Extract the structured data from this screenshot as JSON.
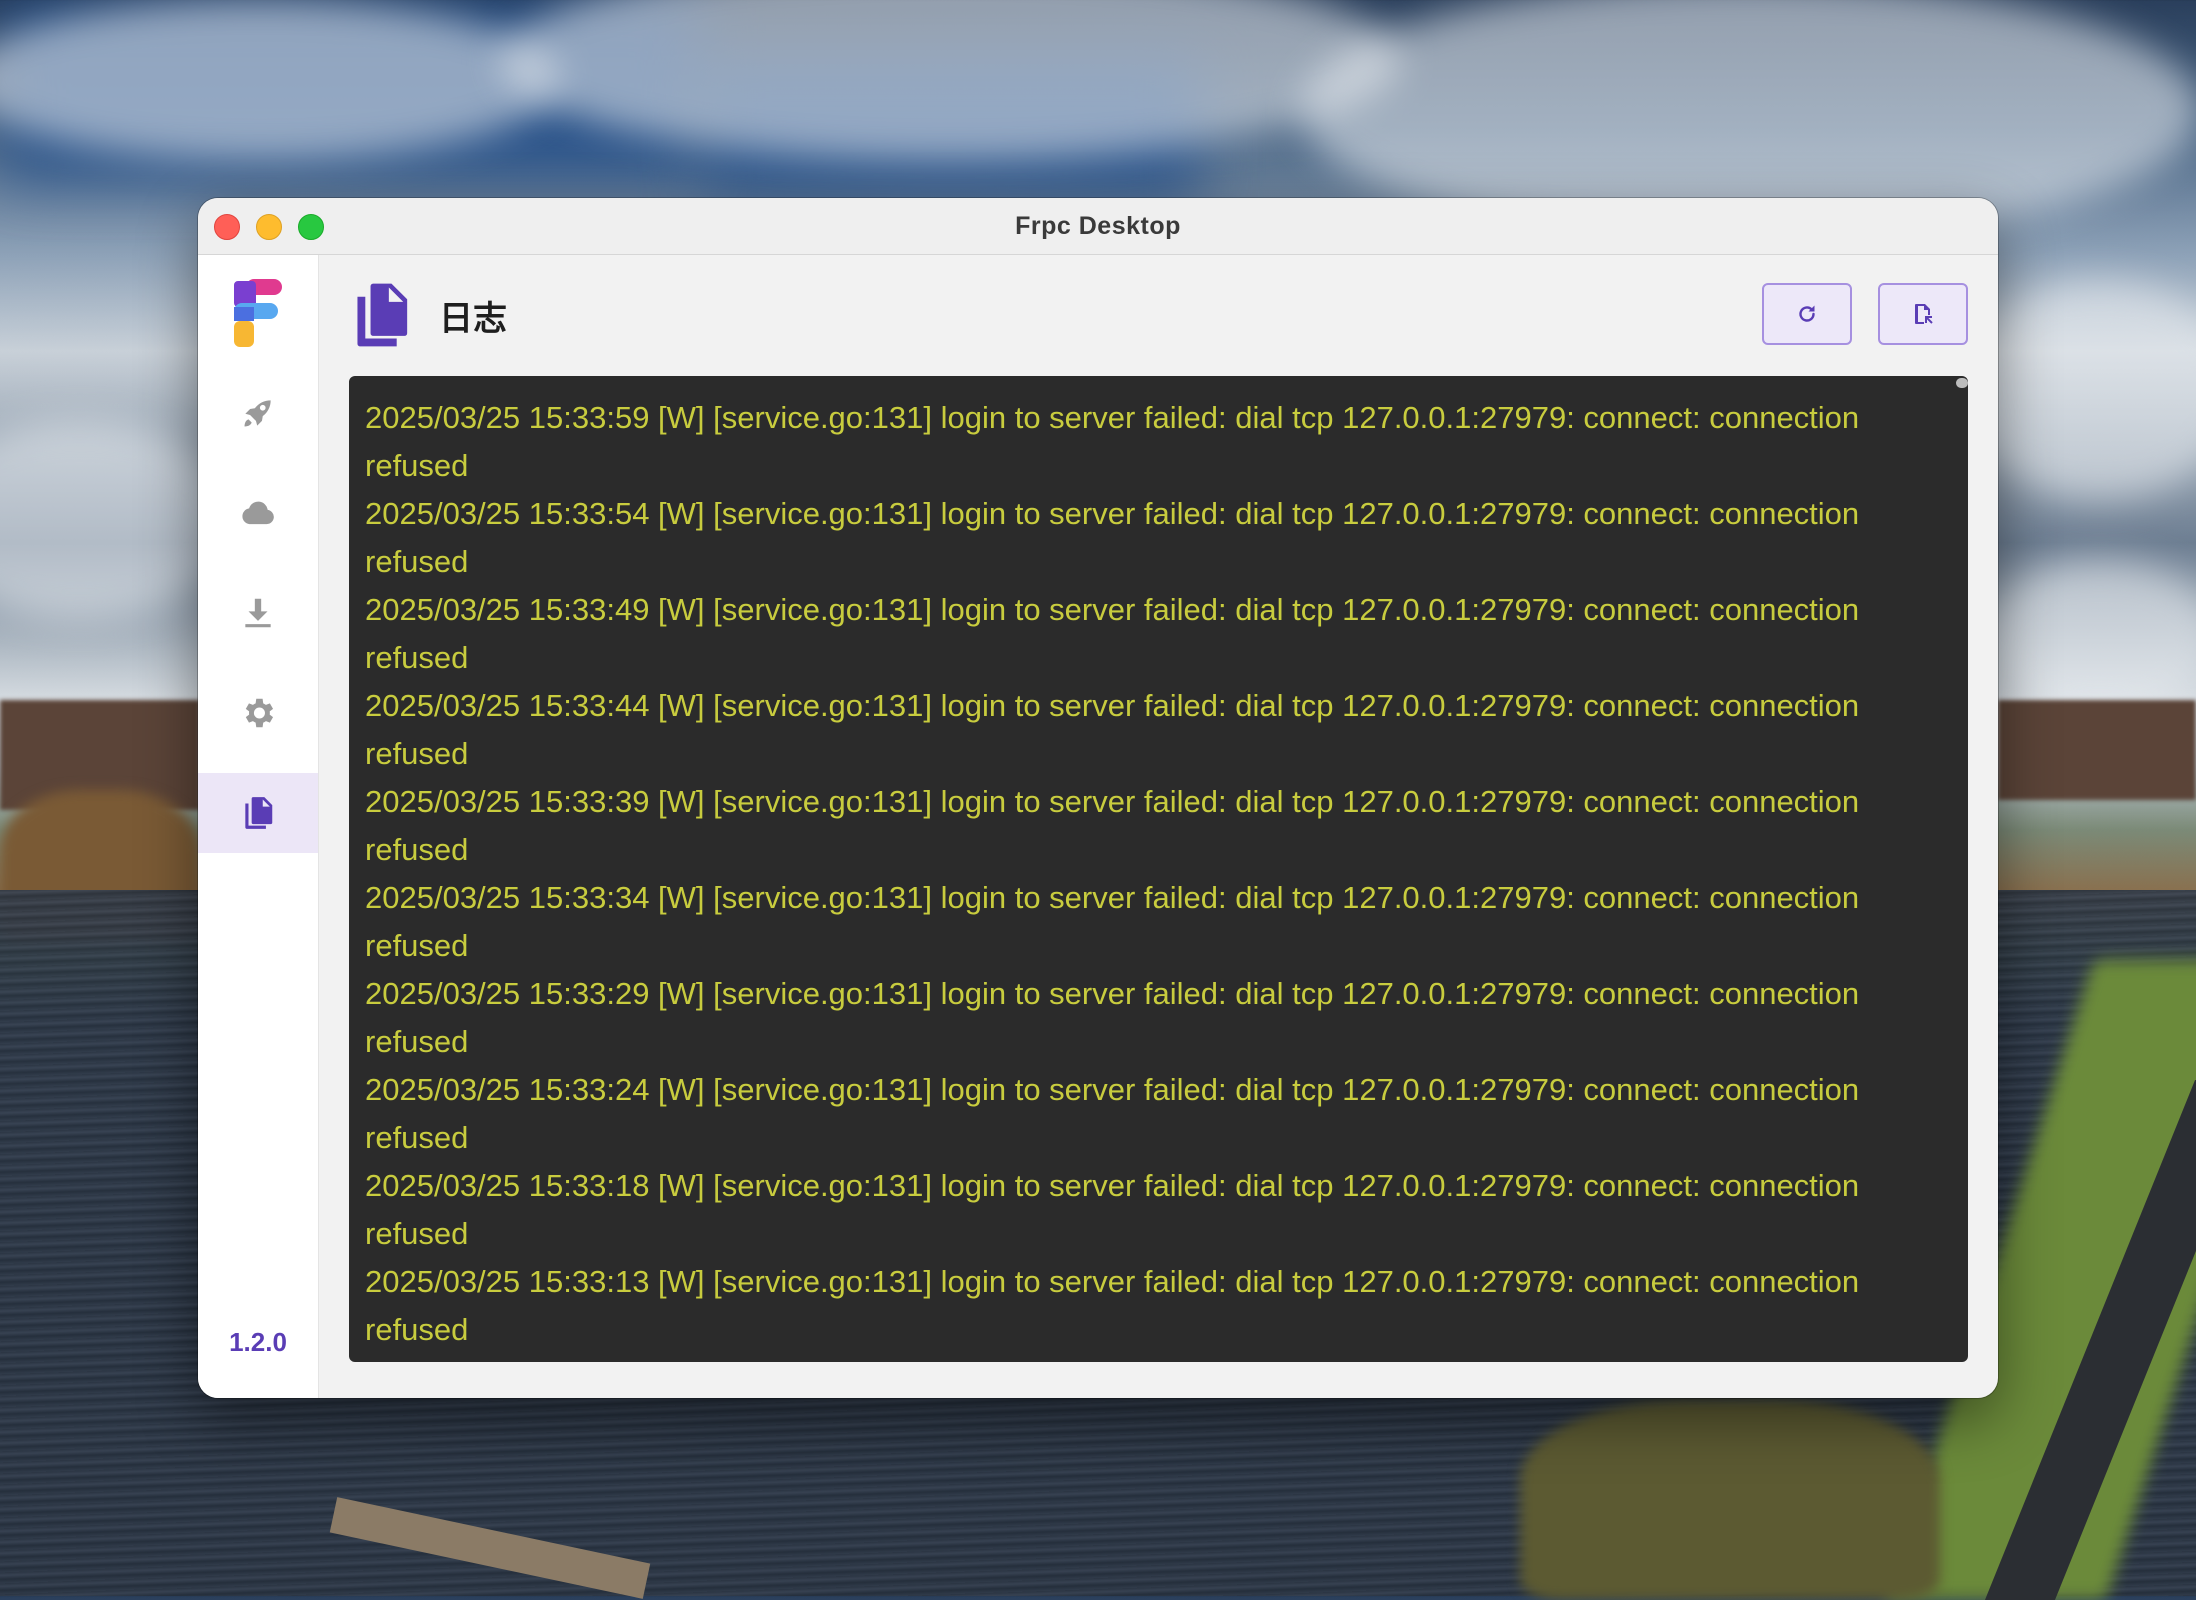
{
  "window": {
    "title": "Frpc Desktop"
  },
  "sidebar": {
    "items": [
      {
        "id": "rocket",
        "icon": "rocket-icon",
        "active": false
      },
      {
        "id": "cloud",
        "icon": "cloud-icon",
        "active": false
      },
      {
        "id": "download",
        "icon": "download-icon",
        "active": false
      },
      {
        "id": "settings",
        "icon": "gear-icon",
        "active": false
      },
      {
        "id": "logs",
        "icon": "document-copy-icon",
        "active": true
      }
    ],
    "version": "1.2.0"
  },
  "header": {
    "title": "日志",
    "icon": "document-copy-icon",
    "buttons": [
      {
        "id": "refresh",
        "icon": "refresh-icon"
      },
      {
        "id": "open-log-file",
        "icon": "file-export-icon"
      }
    ]
  },
  "colors": {
    "accent": "#5a3db5",
    "console_bg": "#2b2b2b",
    "log_text": "#c8cc3e"
  },
  "logs": [
    "2025/03/25 15:33:59 [W] [service.go:131] login to server failed: dial tcp 127.0.0.1:27979: connect: connection refused",
    "2025/03/25 15:33:54 [W] [service.go:131] login to server failed: dial tcp 127.0.0.1:27979: connect: connection refused",
    "2025/03/25 15:33:49 [W] [service.go:131] login to server failed: dial tcp 127.0.0.1:27979: connect: connection refused",
    "2025/03/25 15:33:44 [W] [service.go:131] login to server failed: dial tcp 127.0.0.1:27979: connect: connection refused",
    "2025/03/25 15:33:39 [W] [service.go:131] login to server failed: dial tcp 127.0.0.1:27979: connect: connection refused",
    "2025/03/25 15:33:34 [W] [service.go:131] login to server failed: dial tcp 127.0.0.1:27979: connect: connection refused",
    "2025/03/25 15:33:29 [W] [service.go:131] login to server failed: dial tcp 127.0.0.1:27979: connect: connection refused",
    "2025/03/25 15:33:24 [W] [service.go:131] login to server failed: dial tcp 127.0.0.1:27979: connect: connection refused",
    "2025/03/25 15:33:18 [W] [service.go:131] login to server failed: dial tcp 127.0.0.1:27979: connect: connection refused",
    "2025/03/25 15:33:13 [W] [service.go:131] login to server failed: dial tcp 127.0.0.1:27979: connect: connection refused"
  ]
}
